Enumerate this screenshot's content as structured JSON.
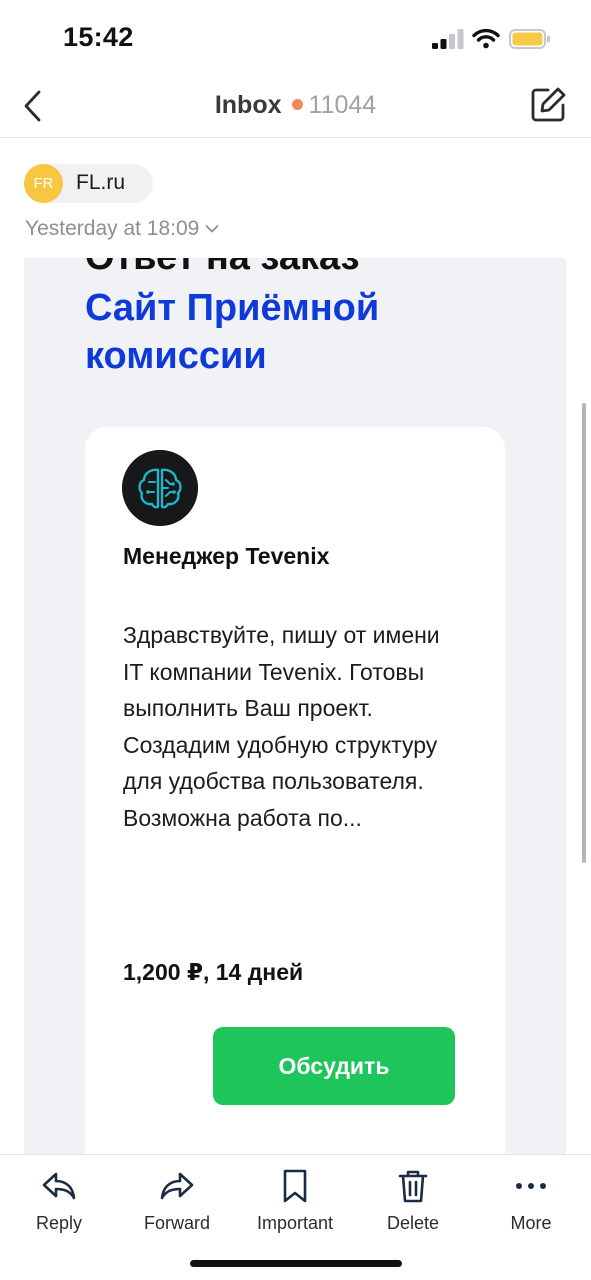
{
  "status_bar": {
    "time": "15:42",
    "icons": [
      "cellular-signal-icon",
      "wifi-icon",
      "battery-icon"
    ],
    "battery_color": "#f7c948"
  },
  "nav": {
    "back_icon": "chevron-left-icon",
    "title": "Inbox",
    "unread_count": "11044",
    "dot_color": "#f08a5d",
    "compose_icon": "compose-icon"
  },
  "message": {
    "sender_initials": "FR",
    "sender_name": "FL.ru",
    "date": "Yesterday at 18:09",
    "avatar_color": "#f7c741"
  },
  "email": {
    "heading_line1": "Ответ на заказ",
    "heading_project_line1": "Сайт Приёмной",
    "heading_project_line2": "комиссии",
    "accent_color": "#0d3ad9",
    "card": {
      "logo_icon": "brain-chip-logo-icon",
      "author": "Менеджер Tevenix",
      "text": "Здравствуйте, пишу от имени IT компании Tevenix. Готовы выполнить Ваш проект. Создадим удобную структуру для удобства пользователя. Возможна работа по...",
      "price": "1,200 ₽, 14 дней",
      "button_label": "Обсудить",
      "button_color": "#1ec55a"
    }
  },
  "toolbar": {
    "items": [
      {
        "label": "Reply",
        "icon": "reply-icon"
      },
      {
        "label": "Forward",
        "icon": "forward-icon"
      },
      {
        "label": "Important",
        "icon": "bookmark-icon"
      },
      {
        "label": "Delete",
        "icon": "trash-icon"
      },
      {
        "label": "More",
        "icon": "more-icon"
      }
    ]
  }
}
